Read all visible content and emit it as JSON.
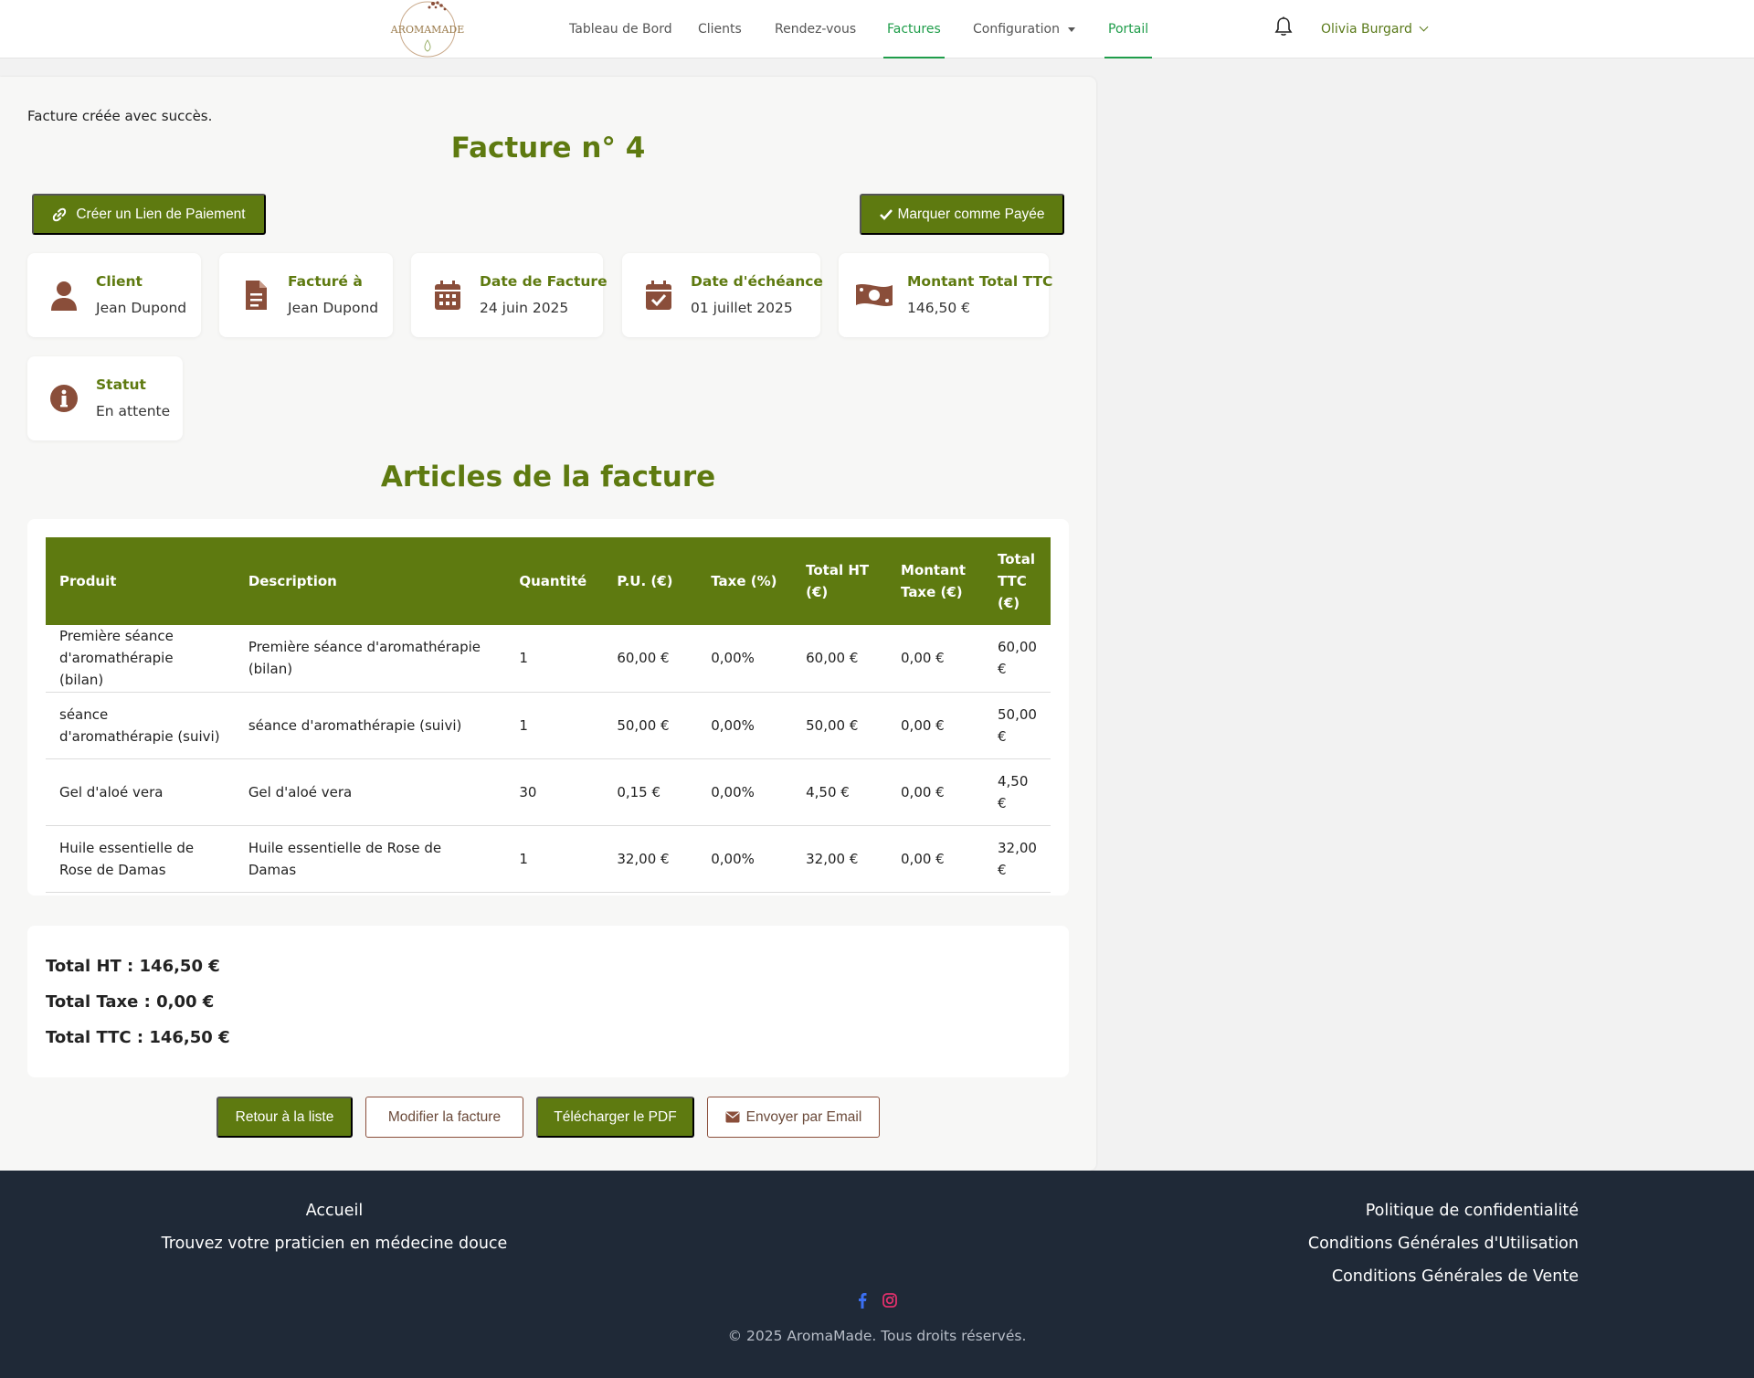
{
  "nav": {
    "logo_text": "AROMAMADE",
    "items": [
      {
        "label": "Tableau de Bord"
      },
      {
        "label": "Clients"
      },
      {
        "label": "Rendez-vous"
      },
      {
        "label": "Factures"
      },
      {
        "label": "Configuration"
      },
      {
        "label": "Portail"
      }
    ],
    "user_name": "Olivia Burgard"
  },
  "alert": "Facture créée avec succès.",
  "invoice": {
    "title": "Facture n° 4",
    "payment_link_label": "Créer un Lien de Paiement",
    "mark_paid_label": "Marquer comme Payée",
    "cards": [
      {
        "icon": "user-icon",
        "label": "Client",
        "value": "Jean Dupond"
      },
      {
        "icon": "file-invoice-icon",
        "label": "Facturé à",
        "value": "Jean Dupond"
      },
      {
        "icon": "calendar-icon",
        "label": "Date de Facture",
        "value": "24 juin 2025"
      },
      {
        "icon": "calendar-check-icon",
        "label": "Date d'échéance",
        "value": "01 juillet 2025"
      },
      {
        "icon": "money-bill-icon",
        "label": "Montant Total TTC",
        "value": "146,50 €"
      },
      {
        "icon": "info-circle-icon",
        "label": "Statut",
        "value": "En attente"
      }
    ]
  },
  "items_section": {
    "title": "Articles de la facture",
    "headers": [
      "Produit",
      "Description",
      "Quantité",
      "P.U. (€)",
      "Taxe (%)",
      "Total HT (€)",
      "Montant Taxe (€)",
      "Total TTC (€)"
    ],
    "rows": [
      [
        "Première séance d'aromathérapie (bilan)",
        "Première séance d'aromathérapie (bilan)",
        "1",
        "60,00 €",
        "0,00%",
        "60,00 €",
        "0,00 €",
        "60,00 €"
      ],
      [
        "séance d'aromathérapie (suivi)",
        "séance d'aromathérapie (suivi)",
        "1",
        "50,00 €",
        "0,00%",
        "50,00 €",
        "0,00 €",
        "50,00 €"
      ],
      [
        "Gel d'aloé vera",
        "Gel d'aloé vera",
        "30",
        "0,15 €",
        "0,00%",
        "4,50 €",
        "0,00 €",
        "4,50 €"
      ],
      [
        "Huile essentielle de Rose de Damas",
        "Huile essentielle de Rose de Damas",
        "1",
        "32,00 €",
        "0,00%",
        "32,00 €",
        "0,00 €",
        "32,00 €"
      ]
    ]
  },
  "totals": {
    "ht": "Total HT : 146,50 €",
    "tax": "Total Taxe : 0,00 €",
    "ttc": "Total TTC : 146,50 €"
  },
  "actions": {
    "back": "Retour à la liste",
    "edit": "Modifier la facture",
    "pdf": "Télécharger le PDF",
    "email": "Envoyer par Email"
  },
  "footer": {
    "left_links": [
      "Accueil",
      "Trouvez votre praticien en médecine douce"
    ],
    "right_links": [
      "Politique de confidentialité",
      "Conditions Générales d'Utilisation",
      "Conditions Générales de Vente"
    ],
    "copyright": "© 2025 AromaMade. Tous droits réservés."
  },
  "colors": {
    "brand_olive": "#5e7a10",
    "icon_brown": "#8a4e3a",
    "nav_active": "#1f9d4a",
    "footer_bg": "#1f2937"
  }
}
